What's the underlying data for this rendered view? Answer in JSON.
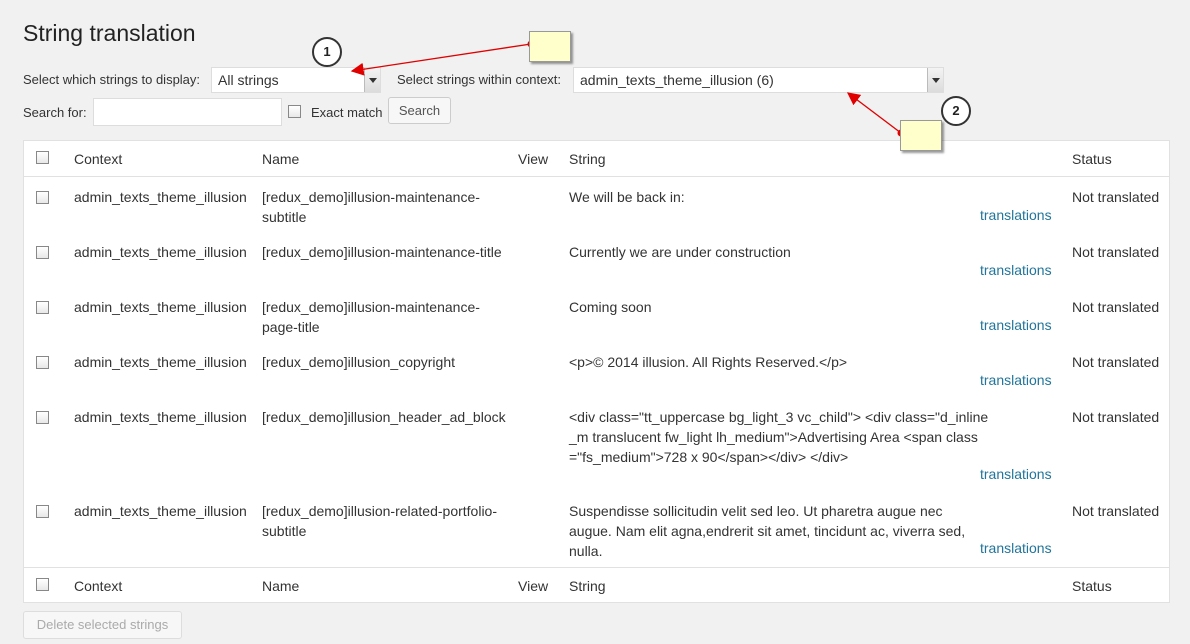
{
  "page": {
    "title": "String translation"
  },
  "filters": {
    "display_label": "Select which strings to display:",
    "display_value": "All strings",
    "context_label": "Select strings within context:",
    "context_value": "admin_texts_theme_illusion (6)",
    "search_label": "Search for:",
    "search_value": "",
    "exact_match_label": "Exact match",
    "search_button": "Search"
  },
  "table": {
    "columns": {
      "context": "Context",
      "name": "Name",
      "view": "View",
      "string": "String",
      "status": "Status"
    },
    "rows": [
      {
        "context": "admin_texts_theme_illusion",
        "name": "[redux_demo]illusion-maintenance-subtitle",
        "string": "We will be back in:",
        "link": "translations",
        "status": "Not translated"
      },
      {
        "context": "admin_texts_theme_illusion",
        "name": "[redux_demo]illusion-maintenance-title",
        "string": "Currently we are under construction",
        "link": "translations",
        "status": "Not translated"
      },
      {
        "context": "admin_texts_theme_illusion",
        "name": "[redux_demo]illusion-maintenance-page-title",
        "string": "Coming soon",
        "link": "translations",
        "status": "Not translated"
      },
      {
        "context": "admin_texts_theme_illusion",
        "name": "[redux_demo]illusion_copyright",
        "string": "<p>© 2014 illusion. All Rights Reserved.</p>",
        "link": "translations",
        "status": "Not translated"
      },
      {
        "context": "admin_texts_theme_illusion",
        "name": "[redux_demo]illusion_header_ad_block",
        "string": "<div class=\"tt_uppercase bg_light_3 vc_child\"> <div class=\"d_inline_m translucent fw_light lh_medium\">Advertising Area <span class=\"fs_medium\">728 x 90</span></div> </div>",
        "link": "translations",
        "status": "Not translated"
      },
      {
        "context": "admin_texts_theme_illusion",
        "name": "[redux_demo]illusion-related-portfolio-subtitle",
        "string": "Suspendisse sollicitudin velit sed leo. Ut pharetra augue nec augue. Nam elit agna,endrerit sit amet, tincidunt ac, viverra sed, nulla.",
        "link": "translations",
        "status": "Not translated"
      }
    ]
  },
  "footer": {
    "delete_button": "Delete selected strings"
  },
  "annotations": {
    "callout_1": "1",
    "callout_2": "2",
    "arrow_color": "#e00000"
  }
}
